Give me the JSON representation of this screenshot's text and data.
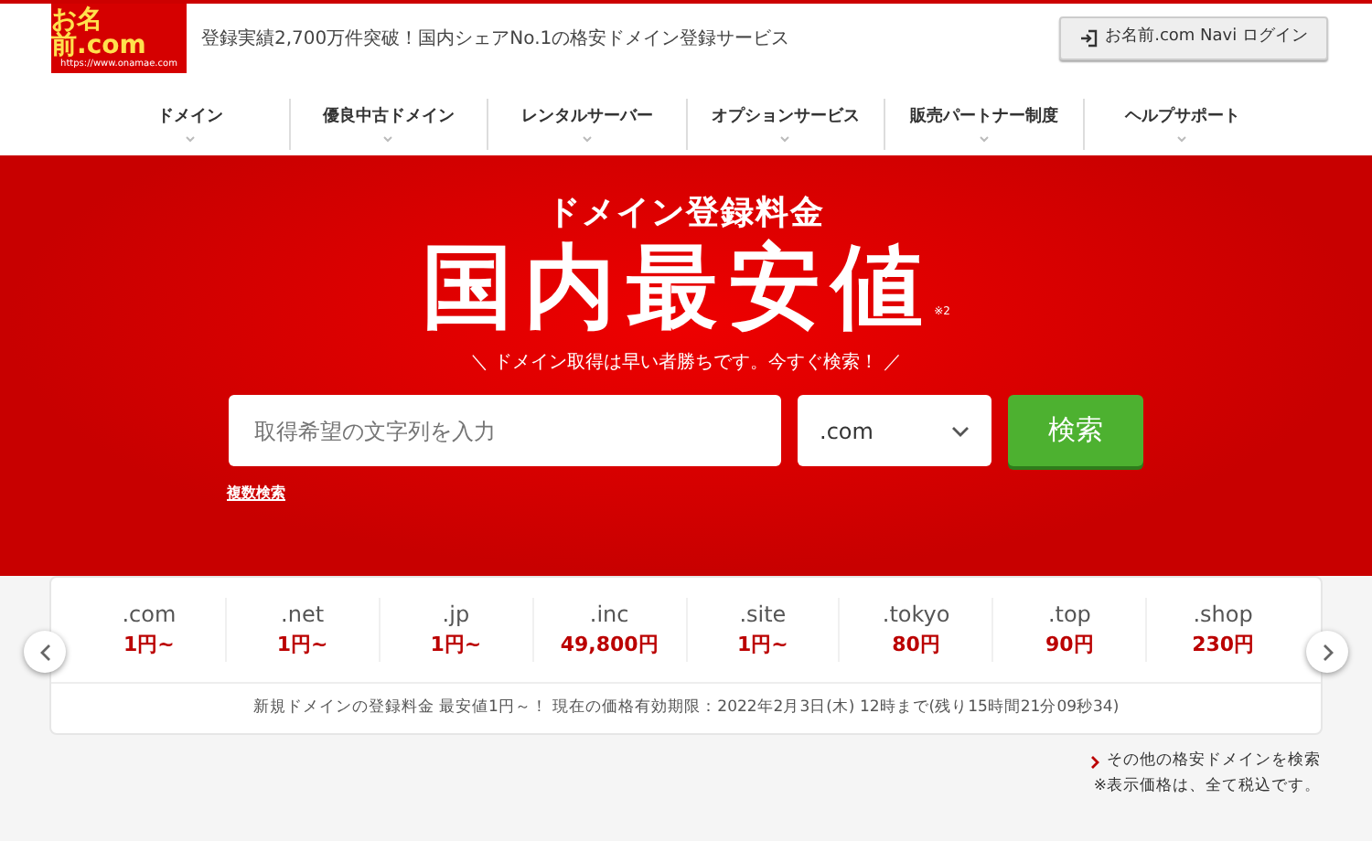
{
  "header": {
    "logo": {
      "name": "お名前.com",
      "url": "https://www.onamae.com"
    },
    "tagline_before": "登録実績2,700万件突破！",
    "tagline_link": "国内シェアNo.1",
    "tagline_after": "の格安ドメイン登録サービス",
    "login_button": "お名前.com Navi ログイン"
  },
  "nav": [
    "ドメイン",
    "優良中古ドメイン",
    "レンタルサーバー",
    "オプションサービス",
    "販売パートナー制度",
    "ヘルプサポート"
  ],
  "hero": {
    "subtitle": "ドメイン登録料金",
    "title": "国内最安値",
    "note": "※2",
    "catchphrase": "＼ ドメイン取得は早い者勝ちです。今すぐ検索！ ／",
    "search": {
      "placeholder": "取得希望の文字列を入力",
      "tld": ".com",
      "button": "検索"
    },
    "multi_search_link": "複数検索"
  },
  "prices": [
    {
      "tld": ".com",
      "price": "1円~"
    },
    {
      "tld": ".net",
      "price": "1円~"
    },
    {
      "tld": ".jp",
      "price": "1円~"
    },
    {
      "tld": ".inc",
      "price": "49,800円"
    },
    {
      "tld": ".site",
      "price": "1円~"
    },
    {
      "tld": ".tokyo",
      "price": "80円"
    },
    {
      "tld": ".top",
      "price": "90円"
    },
    {
      "tld": ".shop",
      "price": "230円"
    }
  ],
  "price_note": "新規ドメインの登録料金 最安値1円～！ 現在の価格有効期限：2022年2月3日(木) 12時まで(残り15時間21分09秒34)",
  "other_link": "その他の格安ドメインを検索",
  "tax_note": "※表示価格は、全て税込です。"
}
